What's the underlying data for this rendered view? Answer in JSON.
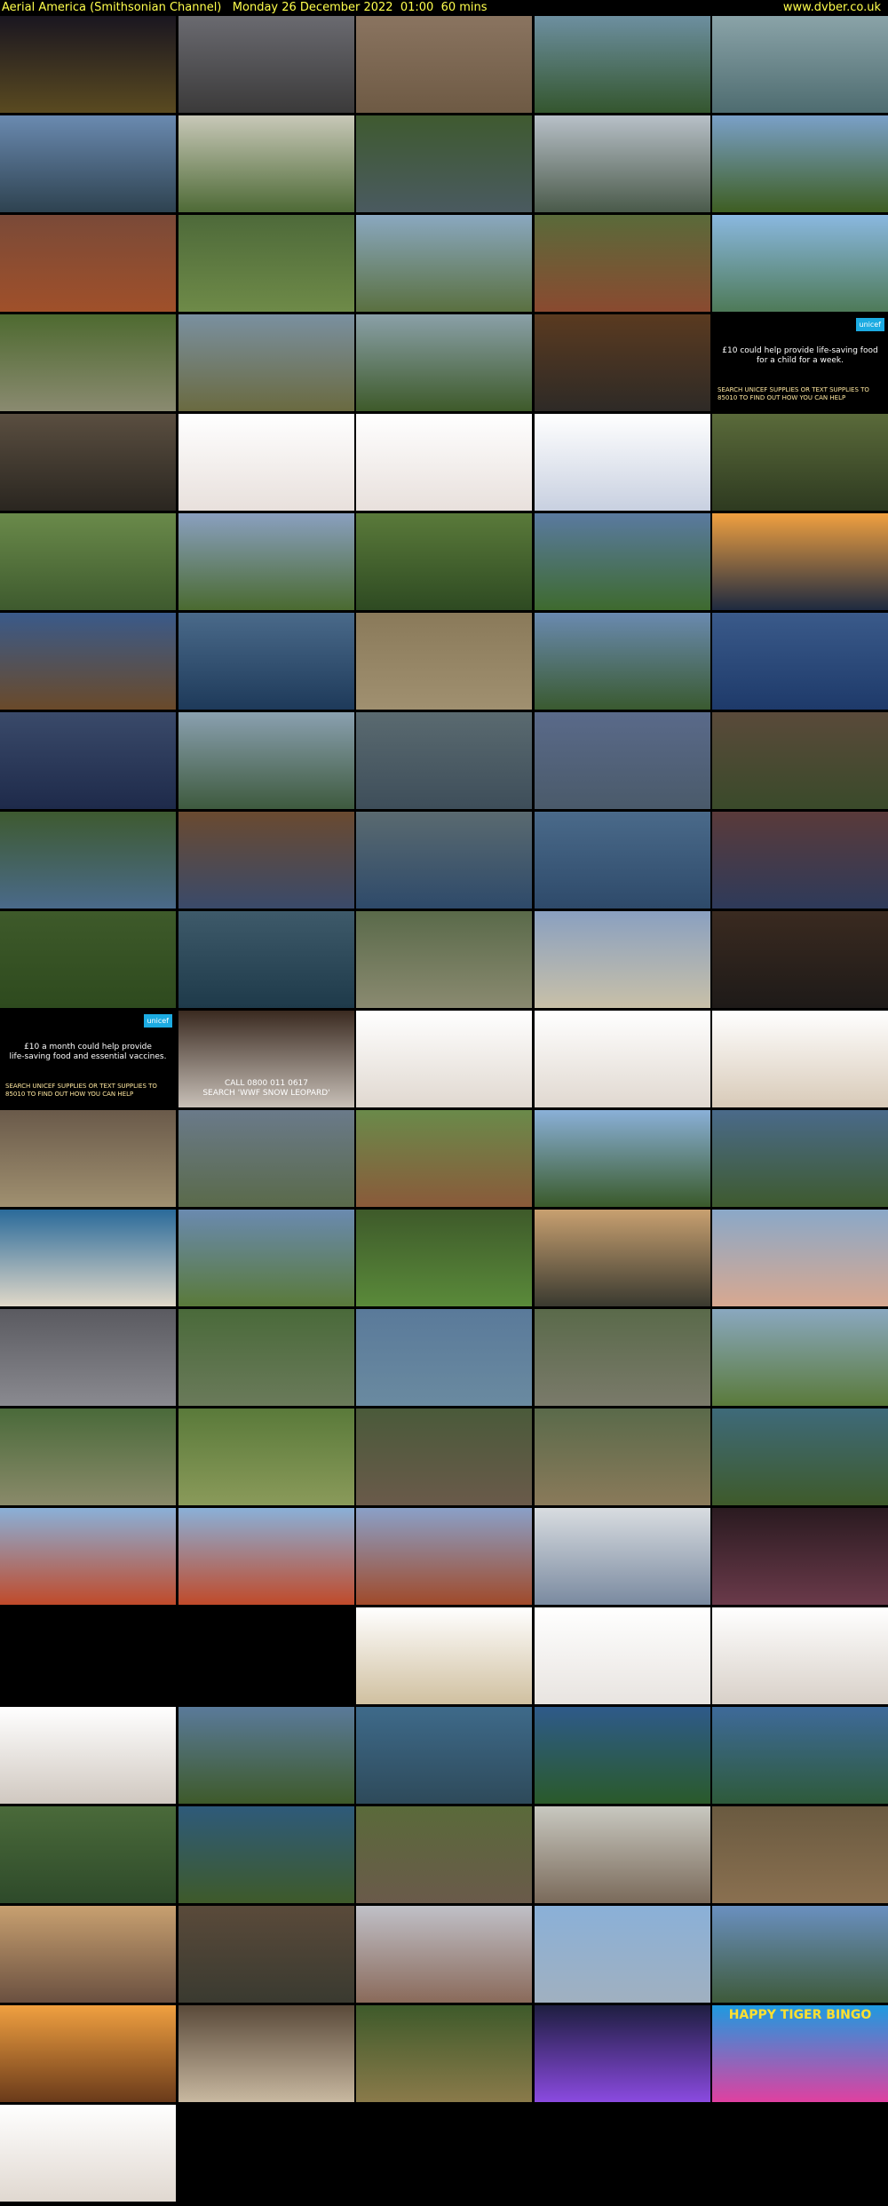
{
  "header": {
    "title": "Aerial America (Smithsonian Channel)",
    "date": "Monday 26 December 2022",
    "time": "01:00",
    "duration": "60 mins",
    "site": "www.dvber.co.uk"
  },
  "captions": {
    "unicef_1_line1": "£10 could help provide life-saving food",
    "unicef_1_line2": "for a child for a week.",
    "unicef_1_cta": "SEARCH UNICEF SUPPLIES OR TEXT SUPPLIES TO 85010 TO FIND OUT HOW YOU CAN HELP",
    "unicef_2_line1": "£10 a month could help provide",
    "unicef_2_line2": "life-saving food and essential vaccines.",
    "unicef_2_cta": "SEARCH UNICEF SUPPLIES OR TEXT SUPPLIES TO 85010 TO FIND OUT HOW YOU CAN HELP",
    "unicef_badge": "unicef",
    "wwf_line1": "CALL 0800 011 0617",
    "wwf_line2": "SEARCH 'WWF SNOW LEOPARD'",
    "bingo": "HAPPY TIGER BINGO"
  },
  "thumbnails": [
    {
      "c1": "#1a1620",
      "c2": "#5a4a20"
    },
    {
      "c1": "#6a6a70",
      "c2": "#3b3a3a"
    },
    {
      "c1": "#8a7460",
      "c2": "#6e5a44"
    },
    {
      "c1": "#6d8fa0",
      "c2": "#34562e"
    },
    {
      "c1": "#8aa3a8",
      "c2": "#4e6c70"
    },
    {
      "c1": "#6a8ab0",
      "c2": "#2e4250"
    },
    {
      "c1": "#c8c8b8",
      "c2": "#4e6a36"
    },
    {
      "c1": "#3f5a30",
      "c2": "#4a5a60"
    },
    {
      "c1": "#b8c0c8",
      "c2": "#4a5a4a"
    },
    {
      "c1": "#7aa0c8",
      "c2": "#3e5e22"
    },
    {
      "c1": "#7a4a38",
      "c2": "#a0502a"
    },
    {
      "c1": "#4e6a3a",
      "c2": "#6e8a48"
    },
    {
      "c1": "#8aa8c0",
      "c2": "#5a7040"
    },
    {
      "c1": "#5a6a3a",
      "c2": "#8a4a30"
    },
    {
      "c1": "#8ab8e0",
      "c2": "#4e7a58"
    },
    {
      "c1": "#4e6a30",
      "c2": "#8a8a70"
    },
    {
      "c1": "#7a90a0",
      "c2": "#6a6a40"
    },
    {
      "c1": "#8aa0a8",
      "c2": "#3e5a2a"
    },
    {
      "c1": "#5a3a20",
      "c2": "#2e2a26"
    },
    {
      "c1": "#000000",
      "c2": "#000000"
    },
    {
      "c1": "#5a4e40",
      "c2": "#2a2620"
    },
    {
      "c1": "#ffffff",
      "c2": "#e8e0dc"
    },
    {
      "c1": "#ffffff",
      "c2": "#e8e0dc"
    },
    {
      "c1": "#ffffff",
      "c2": "#c8d0e0"
    },
    {
      "c1": "#5a6a3a",
      "c2": "#2e3a20"
    },
    {
      "c1": "#6a8a4a",
      "c2": "#3e5a2e"
    },
    {
      "c1": "#8aa0c0",
      "c2": "#4a6a30"
    },
    {
      "c1": "#5a7a3a",
      "c2": "#2e4a22"
    },
    {
      "c1": "#5a7aa0",
      "c2": "#3e6a2e"
    },
    {
      "c1": "#f0a040",
      "c2": "#1e2a40"
    },
    {
      "c1": "#3a5a8a",
      "c2": "#6a4a2a"
    },
    {
      "c1": "#4a6a8a",
      "c2": "#1e3a5a"
    },
    {
      "c1": "#8a7a5a",
      "c2": "#a09070"
    },
    {
      "c1": "#6a8ab0",
      "c2": "#3a5a30"
    },
    {
      "c1": "#3a5a8a",
      "c2": "#1e3a6a"
    },
    {
      "c1": "#3a4a6a",
      "c2": "#1e2a4a"
    },
    {
      "c1": "#8aa0b0",
      "c2": "#3e5a3e"
    },
    {
      "c1": "#5a6a70",
      "c2": "#3e4e5a"
    },
    {
      "c1": "#5a6a8a",
      "c2": "#4a5a6a"
    },
    {
      "c1": "#5a4a3a",
      "c2": "#3a4a2a"
    },
    {
      "c1": "#3e5a30",
      "c2": "#4a6a8a"
    },
    {
      "c1": "#6a4a30",
      "c2": "#3a4a6a"
    },
    {
      "c1": "#5a6a70",
      "c2": "#2e4a6a"
    },
    {
      "c1": "#4a6a8a",
      "c2": "#2e4a6a"
    },
    {
      "c1": "#5a3a3a",
      "c2": "#2e3a5a"
    },
    {
      "c1": "#3e5a2a",
      "c2": "#2e4a1e"
    },
    {
      "c1": "#3e5a6a",
      "c2": "#1e3a4a"
    },
    {
      "c1": "#5a6a4a",
      "c2": "#8a8a70"
    },
    {
      "c1": "#8aa0c0",
      "c2": "#c8c0a8"
    },
    {
      "c1": "#3a2a20",
      "c2": "#1e1a18"
    },
    {
      "c1": "#000000",
      "c2": "#000000"
    },
    {
      "c1": "#3a2a20",
      "c2": "#c8c0b8"
    },
    {
      "c1": "#ffffff",
      "c2": "#e0d8d0"
    },
    {
      "c1": "#ffffff",
      "c2": "#e0d8d0"
    },
    {
      "c1": "#ffffff",
      "c2": "#d8cab8"
    },
    {
      "c1": "#6a5a4a",
      "c2": "#a09070"
    },
    {
      "c1": "#6a7a8a",
      "c2": "#5a6a4a"
    },
    {
      "c1": "#6a8a4a",
      "c2": "#8a5a3a"
    },
    {
      "c1": "#8ab0d8",
      "c2": "#3a5a2a"
    },
    {
      "c1": "#4a6a8a",
      "c2": "#3e5a2e"
    },
    {
      "c1": "#2a6a9a",
      "c2": "#e0d8c8"
    },
    {
      "c1": "#6a8ab0",
      "c2": "#5a7a3a"
    },
    {
      "c1": "#3e5a2a",
      "c2": "#5a8a3a"
    },
    {
      "c1": "#c8a070",
      "c2": "#3a3a30"
    },
    {
      "c1": "#8aa8c8",
      "c2": "#d8a890"
    },
    {
      "c1": "#5a5a60",
      "c2": "#8a8a90"
    },
    {
      "c1": "#4a6a3a",
      "c2": "#6a7a5a"
    },
    {
      "c1": "#5a7a9a",
      "c2": "#6a8aa0"
    },
    {
      "c1": "#5a6a4a",
      "c2": "#7a7a6a"
    },
    {
      "c1": "#8aa8c0",
      "c2": "#5a7a3a"
    },
    {
      "c1": "#4a6a3a",
      "c2": "#8a8a6a"
    },
    {
      "c1": "#5a7a3a",
      "c2": "#8a9a5a"
    },
    {
      "c1": "#4a5a3a",
      "c2": "#6a5a4a"
    },
    {
      "c1": "#5a6a4a",
      "c2": "#8a7a5a"
    },
    {
      "c1": "#3e6a7a",
      "c2": "#3e5a2a"
    },
    {
      "c1": "#8ab0d8",
      "c2": "#c04a2a"
    },
    {
      "c1": "#8ab0d8",
      "c2": "#c04a2a"
    },
    {
      "c1": "#8aa0c8",
      "c2": "#a04a2a"
    },
    {
      "c1": "#d8dce0",
      "c2": "#7a8aa0"
    },
    {
      "c1": "#2a1a20",
      "c2": "#6a3a4a"
    },
    {
      "c1": "#000000",
      "c2": "#000000"
    },
    {
      "c1": "#000000",
      "c2": "#000000"
    },
    {
      "c1": "#ffffff",
      "c2": "#d0c0a0"
    },
    {
      "c1": "#ffffff",
      "c2": "#e8e4e0"
    },
    {
      "c1": "#ffffff",
      "c2": "#d8d0c8"
    },
    {
      "c1": "#ffffff",
      "c2": "#d0c8c0"
    },
    {
      "c1": "#5a7a9a",
      "c2": "#3e5a2a"
    },
    {
      "c1": "#3e6a8a",
      "c2": "#2e4a5a"
    },
    {
      "c1": "#2e5a8a",
      "c2": "#2a5a2a"
    },
    {
      "c1": "#3e6a9a",
      "c2": "#2e5a3a"
    },
    {
      "c1": "#4a6a3a",
      "c2": "#2e4a2a"
    },
    {
      "c1": "#2e5a7a",
      "c2": "#3e5a2a"
    },
    {
      "c1": "#5a6a3a",
      "c2": "#6a5a4a"
    },
    {
      "c1": "#c8c8c0",
      "c2": "#7a6a5a"
    },
    {
      "c1": "#6a5a40",
      "c2": "#8a7050"
    },
    {
      "c1": "#c8a070",
      "c2": "#6a5040"
    },
    {
      "c1": "#5a4a3a",
      "c2": "#3a3a30"
    },
    {
      "c1": "#c0c0c8",
      "c2": "#8a6a5a"
    },
    {
      "c1": "#8ab0d8",
      "c2": "#a0b0c0"
    },
    {
      "c1": "#6a90c0",
      "c2": "#3e5a3a"
    },
    {
      "c1": "#f0a040",
      "c2": "#6a3a1a"
    },
    {
      "c1": "#5a4a3a",
      "c2": "#c8b8a0"
    },
    {
      "c1": "#3e5a2a",
      "c2": "#8a7a4a"
    },
    {
      "c1": "#1e1e40",
      "c2": "#8a4ae0"
    },
    {
      "c1": "#1e9ae0",
      "c2": "#e040a0"
    },
    {
      "c1": "#ffffff",
      "c2": "#e0d8d0"
    }
  ]
}
